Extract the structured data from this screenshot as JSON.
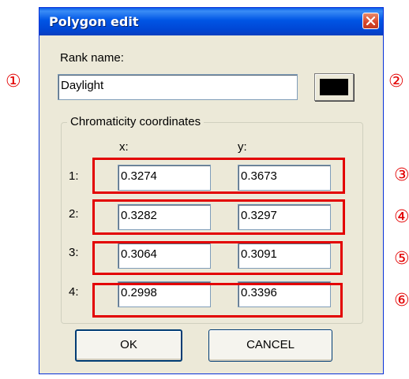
{
  "window": {
    "title": "Polygon edit"
  },
  "rank": {
    "label": "Rank name:",
    "value": "Daylight",
    "color": "#000000"
  },
  "group": {
    "title": "Chromaticity coordinates",
    "x_header": "x:",
    "y_header": "y:",
    "rows": [
      {
        "label": "1:",
        "x": "0.3274",
        "y": "0.3673"
      },
      {
        "label": "2:",
        "x": "0.3282",
        "y": "0.3297"
      },
      {
        "label": "3:",
        "x": "0.3064",
        "y": "0.3091"
      },
      {
        "label": "4:",
        "x": "0.2998",
        "y": "0.3396"
      }
    ]
  },
  "buttons": {
    "ok": "OK",
    "cancel": "CANCEL"
  },
  "callouts": [
    "①",
    "②",
    "③",
    "④",
    "⑤",
    "⑥"
  ],
  "accent": {
    "callout_color": "#e30000",
    "titlebar_color": "#0055e5"
  }
}
